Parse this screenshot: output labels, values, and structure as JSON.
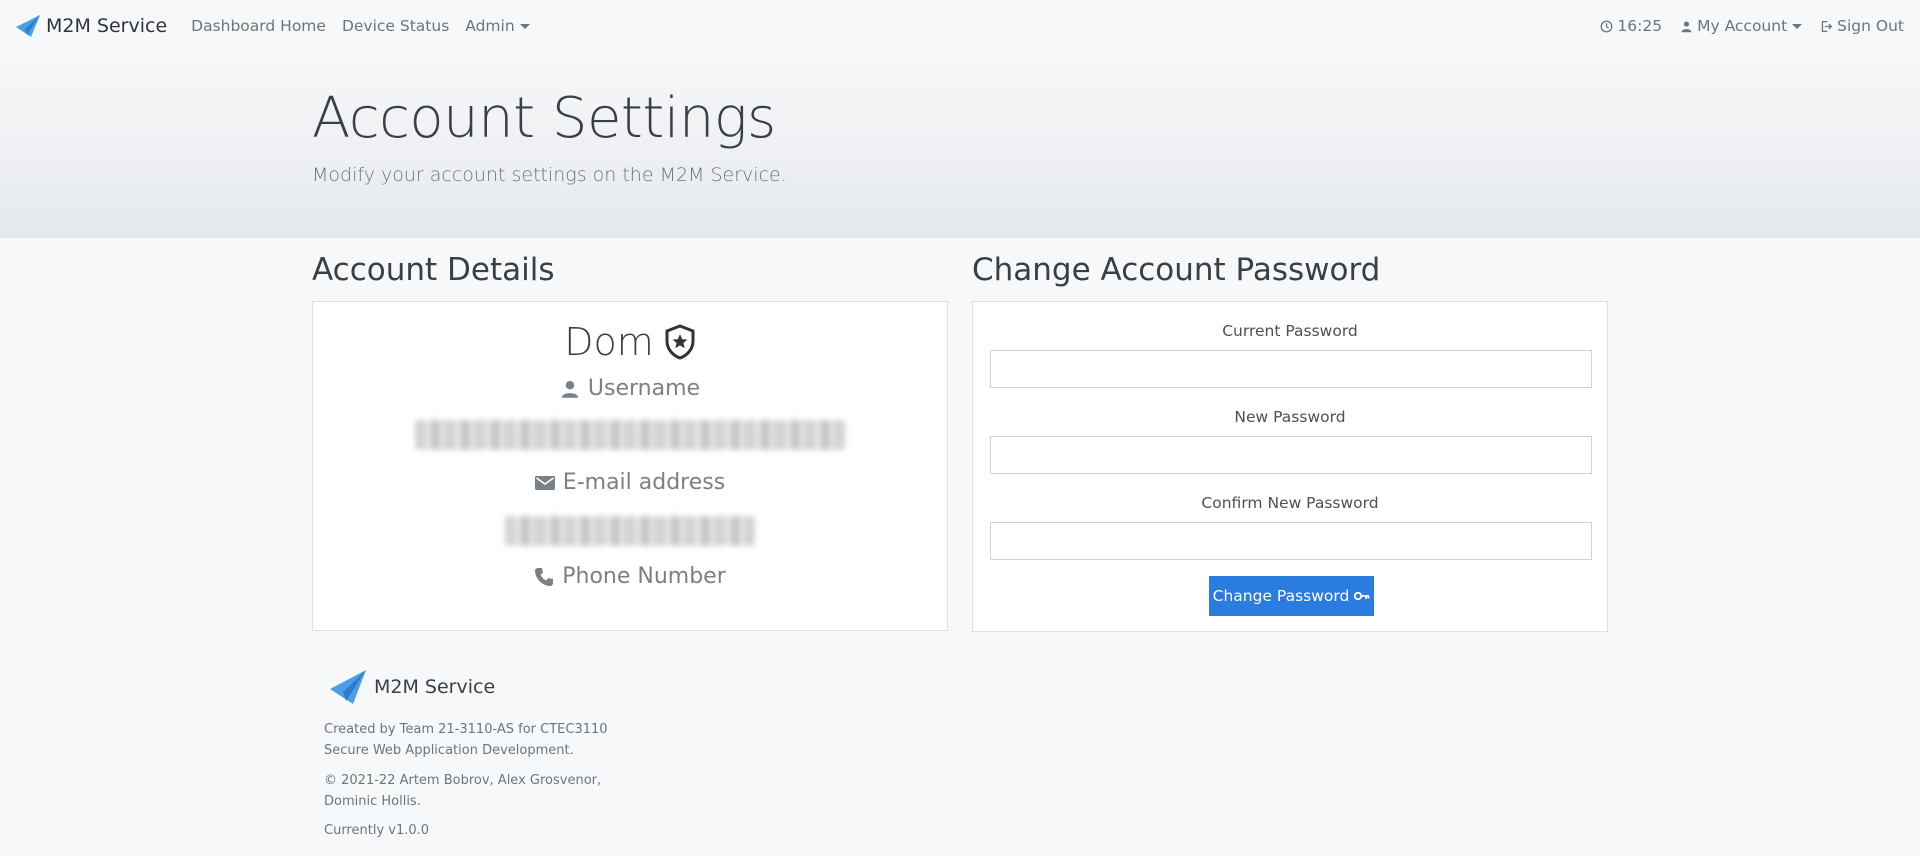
{
  "nav": {
    "brand": "M2M Service",
    "links": [
      "Dashboard Home",
      "Device Status",
      "Admin"
    ],
    "time": "16:25",
    "account": "My Account",
    "signout": "Sign Out"
  },
  "hero": {
    "title": "Account Settings",
    "subtitle": "Modify your account settings on the M2M Service."
  },
  "details": {
    "heading": "Account Details",
    "name": "Dom",
    "username_label": "Username",
    "username_value": "",
    "email_label": "E-mail address",
    "email_value": "",
    "phone_label": "Phone Number"
  },
  "password": {
    "heading": "Change Account Password",
    "current_label": "Current Password",
    "new_label": "New Password",
    "confirm_label": "Confirm New Password",
    "button_label": "Change Password"
  },
  "footer": {
    "brand": "M2M Service",
    "created": "Created by Team 21-3110-AS for CTEC3110 Secure Web Application Development.",
    "copyright": "© 2021-22 Artem Bobrov, Alex Grosvenor, Dominic Hollis.",
    "version": "Currently v1.0.0"
  },
  "colors": {
    "accent": "#2a7ce0",
    "background": "#f7f8fa",
    "logo": "#4a9fe6"
  }
}
